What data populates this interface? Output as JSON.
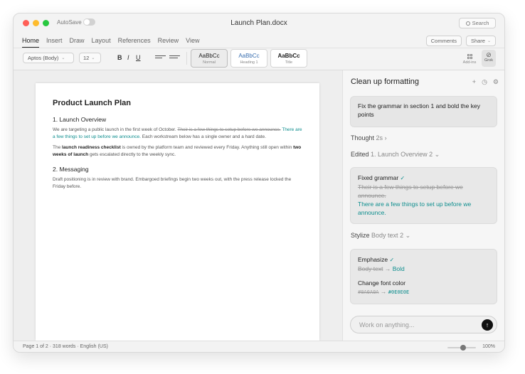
{
  "titlebar": {
    "autosave_label": "AutoSave",
    "doc_title": "Launch Plan.docx",
    "search_label": "Search"
  },
  "menu": {
    "tabs": [
      {
        "label": "Home"
      },
      {
        "label": "Insert"
      },
      {
        "label": "Draw"
      },
      {
        "label": "Layout"
      },
      {
        "label": "References"
      },
      {
        "label": "Review"
      },
      {
        "label": "View"
      }
    ],
    "comments_label": "Comments",
    "share_label": "Share"
  },
  "ribbon": {
    "font_value": "Aptos (Body)",
    "size_value": "12",
    "bold_label": "B",
    "italic_label": "I",
    "underline_label": "U",
    "styles": [
      {
        "sample": "AaBbCc",
        "name": "Normal",
        "color": "#333333"
      },
      {
        "sample": "AaBbCc",
        "name": "Heading 1",
        "color": "#3a6fb0"
      },
      {
        "sample": "AaBbCc",
        "name": "Title",
        "color": "#222222"
      }
    ],
    "addins_label": "Add-ins",
    "grok_label": "Grok"
  },
  "document": {
    "title": "Product Launch Plan",
    "section1_heading": "1. Launch Overview",
    "p1_text_a": "We are targeting a public launch in the first week of October. ",
    "p1_deleted": "Their is a few things to setup before we announce.",
    "p1_inserted": " There are a few things to set up before we announce.",
    "p1_text_b": " Each workstream below has a single owner and a hard date.",
    "p2_text_a": "The ",
    "p2_bold_a": "launch readiness checklist",
    "p2_text_b": " is owned by the platform team and reviewed every Friday. Anything still open within ",
    "p2_bold_b": "two weeks of launch",
    "p2_text_c": " gets escalated directly to the weekly sync.",
    "section2_heading": "2. Messaging",
    "p3_text": "Draft positioning is in review with brand. Embargoed briefings begin two weeks out, with the press release locked the Friday before."
  },
  "panel": {
    "title": "Clean up formatting",
    "prompt": "Fix the grammar in section 1 and bold the key points",
    "thought_label": "Thought",
    "thought_time": "2s",
    "edited_label": "Edited",
    "edited_target": "1. Launch Overview",
    "edited_count": "2",
    "card1_title": "Fixed grammar",
    "card1_deleted": "Their is a few things to setup before we announce.",
    "card1_inserted": "There are a few things to set up before we announce.",
    "stylize_label": "Stylize",
    "stylize_target": "Body text",
    "stylize_count": "2",
    "card2_title1": "Emphasize",
    "card2_old1": "Body text",
    "card2_new1": "Bold",
    "card2_title2": "Change font color",
    "card2_old2": "#0A0A0A",
    "card2_new2": "#0E0E0E",
    "input_placeholder": "Work on anything..."
  },
  "statusbar": {
    "text": "Page 1 of 2 · 318 words · English (US)",
    "zoom_label": "100%",
    "zoom_value": 0.55
  },
  "colors": {
    "accent_teal": "#0e8e8e"
  }
}
